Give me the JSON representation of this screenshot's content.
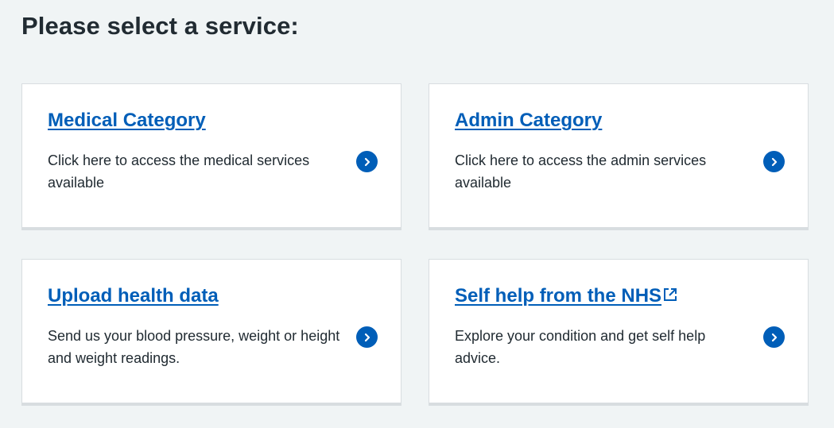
{
  "page": {
    "title": "Please select a service:"
  },
  "cards": [
    {
      "title": "Medical Category",
      "description": "Click here to access the medical services available",
      "icon": "chevron-right-icon",
      "external": false
    },
    {
      "title": "Admin Category",
      "description": "Click here to access the admin services available",
      "icon": "chevron-right-icon",
      "external": false
    },
    {
      "title": "Upload health data",
      "description": "Send us your blood pressure, weight or height and weight readings.",
      "icon": "chevron-right-icon",
      "external": false
    },
    {
      "title": "Self help from the NHS",
      "description": "Explore your condition and get self help advice.",
      "icon": "chevron-right-icon",
      "external": true,
      "external_icon": "external-link-icon"
    }
  ],
  "colors": {
    "background": "#f0f4f5",
    "card": "#ffffff",
    "link": "#005eb8",
    "text": "#212b32",
    "card_border": "#d8dde0",
    "button": "#005eb8"
  }
}
